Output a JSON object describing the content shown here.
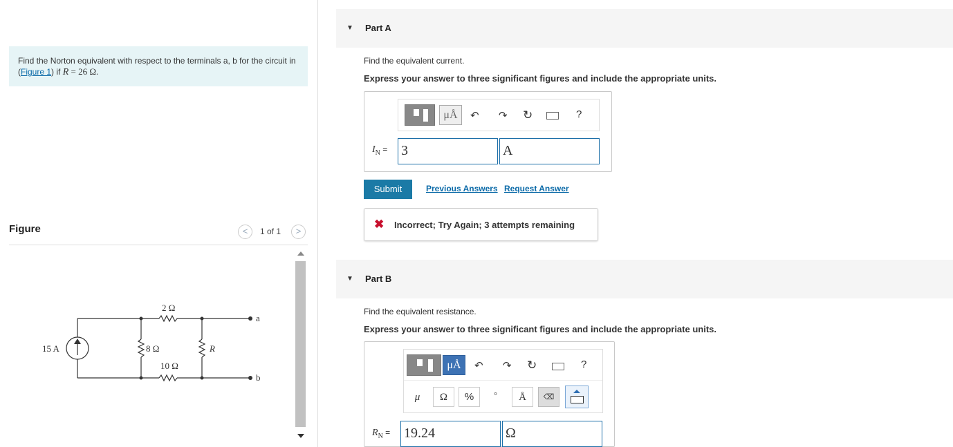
{
  "problem": {
    "text_before": "Find the Norton equivalent with respect to the terminals a, b for the circuit in (",
    "figure_link": "Figure 1",
    "text_mid": ") if ",
    "var": "R",
    "value": " = 26 Ω."
  },
  "figure": {
    "label": "Figure",
    "counter": "1 of 1",
    "prev_icon": "chevron-left-icon",
    "next_icon": "chevron-right-icon",
    "circuit": {
      "source": "15 A",
      "r1": "2 Ω",
      "r2": "8 Ω",
      "r3": "10 Ω",
      "r_load": "R",
      "terminal_a": "a",
      "terminal_b": "b"
    }
  },
  "partA": {
    "title": "Part A",
    "question": "Find the equivalent current.",
    "instruction": "Express your answer to three significant figures and include the appropriate units.",
    "toolbar": {
      "units_label": "μÅ",
      "help": "?"
    },
    "answer_label_var": "I",
    "answer_label_sub": "N",
    "answer_label_eq": " =",
    "value": "3",
    "units": "A",
    "submit": "Submit",
    "previous_answers": "Previous Answers",
    "request_answer": "Request Answer",
    "feedback": "Incorrect; Try Again; 3 attempts remaining"
  },
  "partB": {
    "title": "Part B",
    "question": "Find the equivalent resistance.",
    "instruction": "Express your answer to three significant figures and include the appropriate units.",
    "toolbar": {
      "units_label": "μÅ",
      "help": "?"
    },
    "symbols": [
      "μ",
      "Ω",
      "%",
      "°",
      "Å"
    ],
    "answer_label_var": "R",
    "answer_label_sub": "N",
    "answer_label_eq": " =",
    "value": "19.24",
    "units": "Ω"
  },
  "colors": {
    "accent": "#1b7aa6",
    "problem_bg": "#e6f4f6",
    "error": "#c8102e"
  }
}
